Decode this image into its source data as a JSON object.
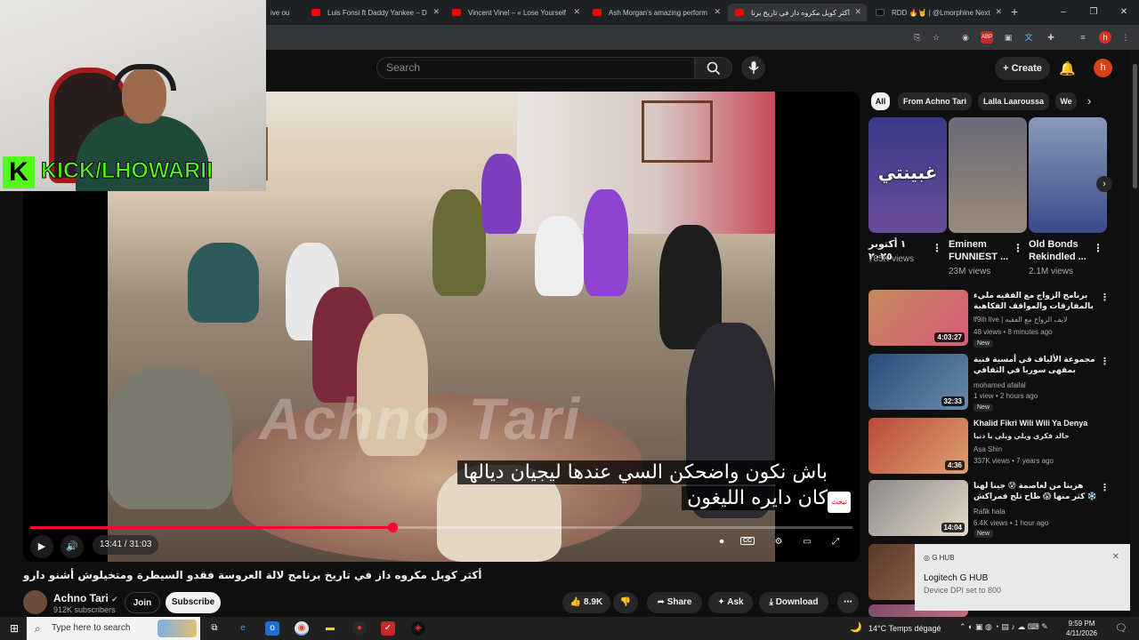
{
  "browser": {
    "tabs": [
      {
        "title": "ive ou",
        "icon": "youtube"
      },
      {
        "title": "Luis Fonsi ft Daddy Yankee – D",
        "icon": "youtube"
      },
      {
        "title": "Vincent Vinel – « Lose Yourself",
        "icon": "youtube"
      },
      {
        "title": "Ash Morgan's amazing perform",
        "icon": "youtube"
      },
      {
        "title": "أكثر كوبل مكروه داز في تاريخ برنا",
        "icon": "youtube",
        "active": true
      },
      {
        "title": "RDD 🔥🤘 | @Lmorphine Next",
        "icon": "tiktok"
      }
    ],
    "new_tab": "+",
    "window_controls": [
      "–",
      "❐",
      "✕"
    ],
    "profile_initial": "h"
  },
  "youtube": {
    "search_placeholder": "Search",
    "create_label": "Create",
    "avatar_initial": "h",
    "player": {
      "watermark": "Achno Tari",
      "subtitle_lines": [
        "باش نكون واضحكن السي عندها ليجيان ديالها",
        "كان دايره الليغون"
      ],
      "time_current": "13:41",
      "time_total": "31:03",
      "time_display": "13:41 / 31:03",
      "progress_fraction": 0.441,
      "channel_bug": "تبحث"
    },
    "video_title": "أكثر كوبل مكروه داز في تاريخ برنامج لالة العروسة فقدو السيطرة ومتخيلوش أشنو دارو",
    "channel": {
      "name": "Achno Tari",
      "subscribers": "912K subscribers",
      "verified": true
    },
    "actions": {
      "join": "Join",
      "subscribe": "Subscribe",
      "likes": "8.9K",
      "share": "Share",
      "ask": "Ask",
      "download": "Download"
    },
    "chips": [
      {
        "label": "All",
        "selected": true
      },
      {
        "label": "From Achno Tari"
      },
      {
        "label": "Lalla Laaroussa"
      },
      {
        "label": "We"
      }
    ],
    "shorts": [
      {
        "title": "١ أكتوبر ٢٠٢٥",
        "views": "785K views",
        "overlay": "غبينتي"
      },
      {
        "title": "Eminem FUNNIEST ...",
        "views": "23M views"
      },
      {
        "title": "Old Bonds Rekindled ...",
        "views": "2.1M views"
      }
    ],
    "recommendations": [
      {
        "title": "برنامج الزواج مع الفقيه مليء بالمفارقات والمواقف الفكاهية",
        "channel": "lf9ih live | لايف الزواج مع الفقيه",
        "meta": "48 views • 8 minutes ago",
        "badge": "New",
        "duration": "4:03:27"
      },
      {
        "title": "مجموعة الألياف في أمسية فنية بمقهى سوريا في الثقافي تطوان",
        "channel": "mohamed afailal",
        "meta": "1 view • 2 hours ago",
        "badge": "New",
        "duration": "32:33"
      },
      {
        "title": "Khalid Fikri Wili Wili Ya Denya",
        "subtitle": "خالد فكري ويلي ويلي يا دنيا",
        "channel": "Asa Shin",
        "meta": "337K views • 7 years ago",
        "duration": "4:36"
      },
      {
        "title": "هربنا من لعاصمة 😰 جينا لهنا كثر منها 😱 طاح تلج فمراكش ❄️",
        "channel": "Rafik hala",
        "meta": "6.4K views • 1 hour ago",
        "badge": "New",
        "duration": "14:04"
      }
    ]
  },
  "webcam_overlay": {
    "text": "KICK/LHOWARII",
    "logo_letter": "K"
  },
  "notification": {
    "app": "G HUB",
    "title": "Logitech G HUB",
    "body": "Device DPI set to 800",
    "close": "✕"
  },
  "taskbar": {
    "search_placeholder": "Type here to search",
    "weather": "14°C  Temps dégagé",
    "time": "9:59 PM",
    "date": "4/11/2026"
  }
}
